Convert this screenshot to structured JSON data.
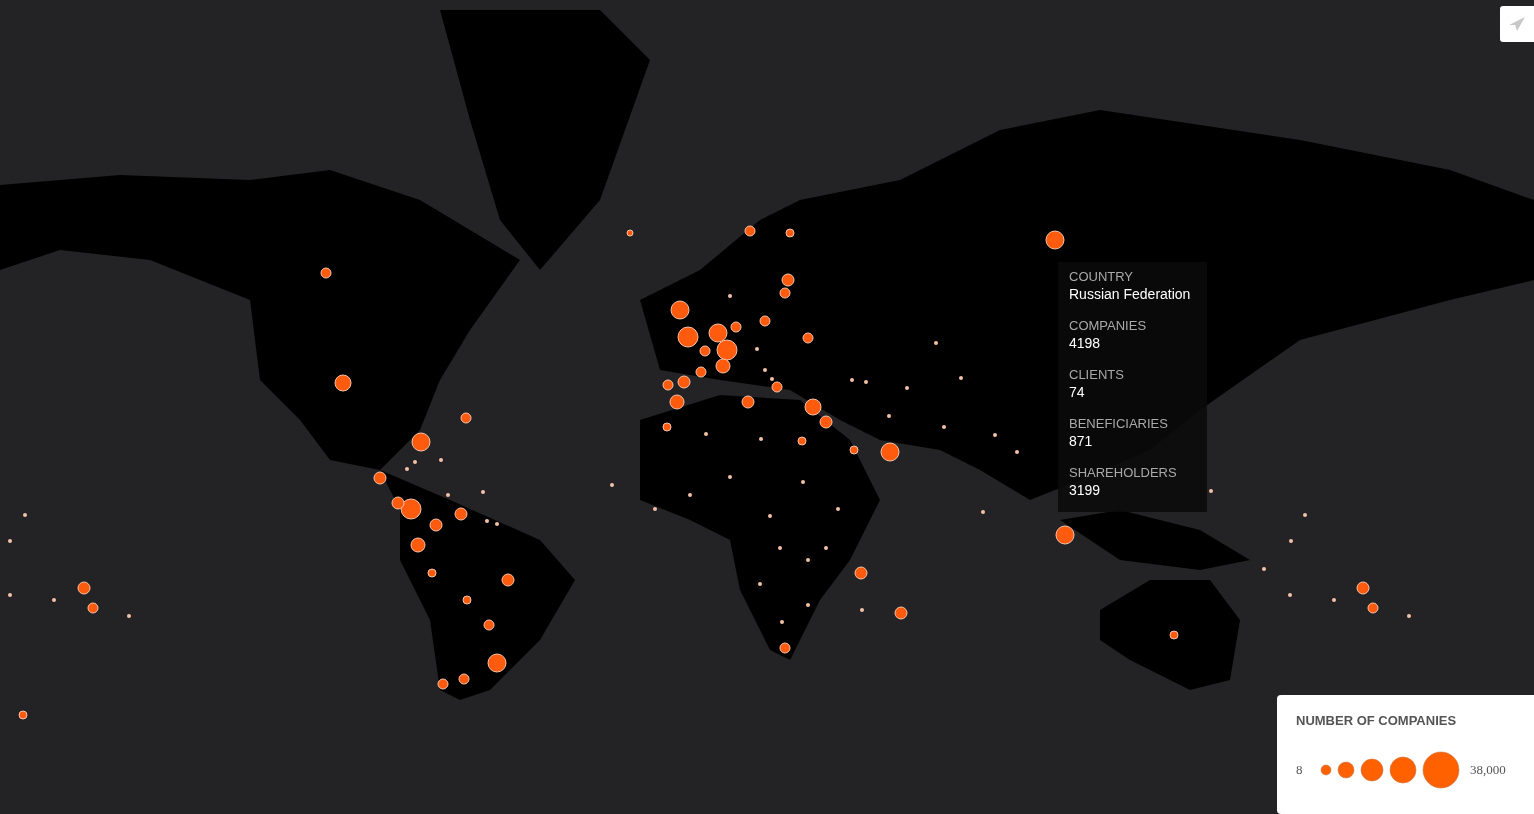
{
  "tooltip": {
    "fields": [
      {
        "label": "COUNTRY",
        "value": "Russian Federation"
      },
      {
        "label": "COMPANIES",
        "value": "4198"
      },
      {
        "label": "CLIENTS",
        "value": "74"
      },
      {
        "label": "BENEFICIARIES",
        "value": "871"
      },
      {
        "label": "SHAREHOLDERS",
        "value": "3199"
      }
    ]
  },
  "legend": {
    "title": "NUMBER OF COMPANIES",
    "min": "8",
    "max": "38,000"
  }
}
